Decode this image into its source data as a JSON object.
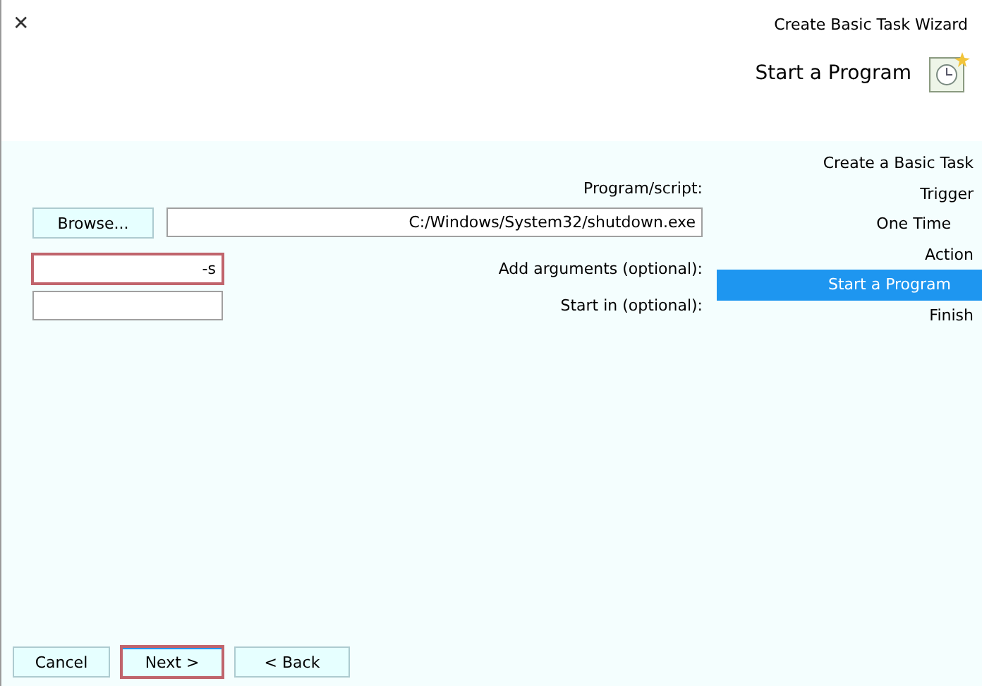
{
  "window": {
    "title": "Create Basic Task Wizard",
    "close": "✕"
  },
  "header": {
    "title": "Start a Program"
  },
  "steps": [
    {
      "label": "Create a Basic Task",
      "selected": false
    },
    {
      "label": "Trigger",
      "selected": false,
      "children": [
        {
          "label": "One Time",
          "selected": false
        }
      ]
    },
    {
      "label": "Action",
      "selected": false,
      "children": [
        {
          "label": "Start a Program",
          "selected": true
        }
      ]
    },
    {
      "label": "Finish",
      "selected": false
    }
  ],
  "form": {
    "program_label": "Program/script:",
    "program_value": "C:/Windows/System32/shutdown.exe",
    "browse": "Browse...",
    "fields": [
      {
        "label": "Add arguments (optional):",
        "value": "-s",
        "highlighted": true
      },
      {
        "label": "Start in (optional):",
        "highlighted": false
      }
    ]
  },
  "buttons": [
    {
      "label": "Cancel",
      "highlighted": false
    },
    {
      "label": "Next >",
      "highlighted": true
    },
    {
      "label": "< Back",
      "highlighted": false
    }
  ]
}
